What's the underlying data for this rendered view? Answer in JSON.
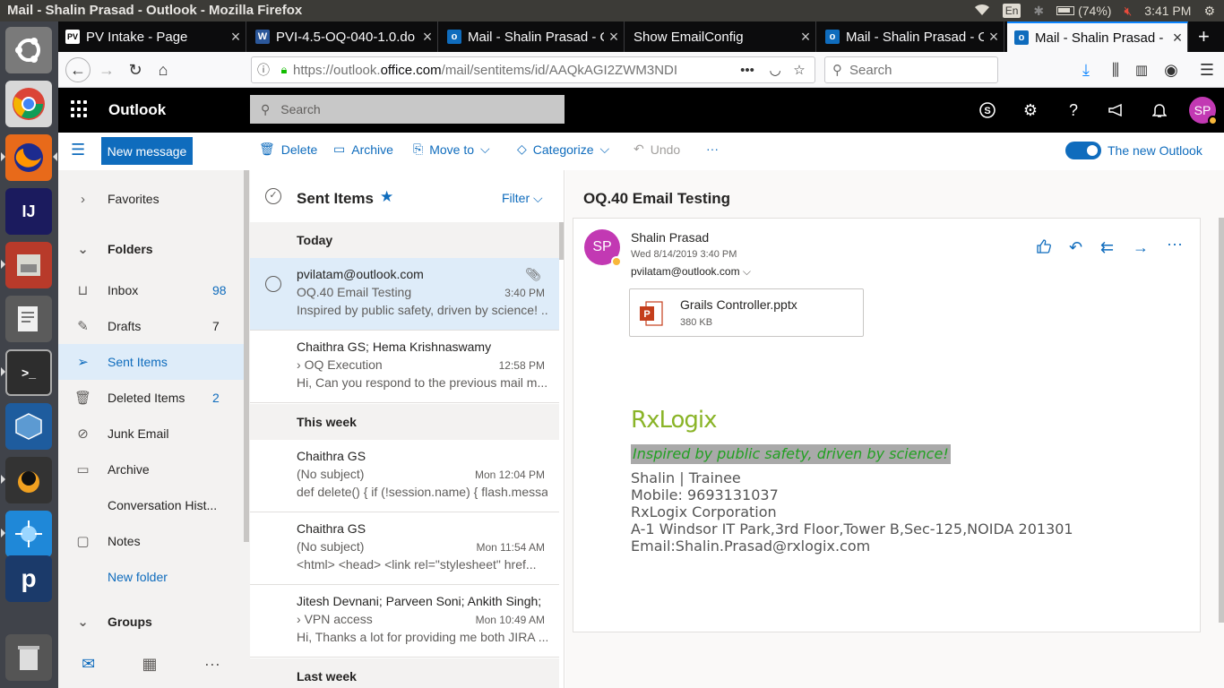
{
  "os": {
    "window_title": "Mail - Shalin Prasad - Outlook - Mozilla Firefox",
    "keyboard": "En",
    "battery": "(74%)",
    "clock": "3:41 PM"
  },
  "browser": {
    "tabs": [
      {
        "label": "PV Intake - Page",
        "icon": "pv-favicon"
      },
      {
        "label": "PVI-4.5-OQ-040-1.0.do",
        "icon": "word-favicon"
      },
      {
        "label": "Mail - Shalin Prasad - O",
        "icon": "outlook-favicon"
      },
      {
        "label": "Show EmailConfig",
        "icon": "none"
      },
      {
        "label": "Mail - Shalin Prasad - O",
        "icon": "outlook-favicon"
      },
      {
        "label": "Mail - Shalin Prasad - O",
        "icon": "outlook-favicon"
      }
    ],
    "url_prefix": "https://outlook.",
    "url_domain": "office.com",
    "url_path": "/mail/sentitems/id/AAQkAGI2ZWM3NDI",
    "search_placeholder": "Search"
  },
  "outlook": {
    "brand": "Outlook",
    "search_placeholder": "Search",
    "avatar_initials": "SP",
    "commands": {
      "new_message": "New message",
      "delete": "Delete",
      "archive": "Archive",
      "move_to": "Move to",
      "categorize": "Categorize",
      "undo": "Undo",
      "more": "···",
      "new_outlook": "The new Outlook"
    },
    "folders": {
      "favorites": "Favorites",
      "folders": "Folders",
      "items": [
        {
          "label": "Inbox",
          "count": "98",
          "icon": "inbox-icon"
        },
        {
          "label": "Drafts",
          "count": "7",
          "icon": "pencil-icon"
        },
        {
          "label": "Sent Items",
          "count": "",
          "icon": "send-icon"
        },
        {
          "label": "Deleted Items",
          "count": "2",
          "icon": "trash-icon"
        },
        {
          "label": "Junk Email",
          "count": "",
          "icon": "block-icon"
        },
        {
          "label": "Archive",
          "count": "",
          "icon": "archive-icon"
        },
        {
          "label": "Conversation Hist...",
          "count": "",
          "icon": "none"
        },
        {
          "label": "Notes",
          "count": "",
          "icon": "note-icon"
        }
      ],
      "new_folder": "New folder",
      "groups": "Groups"
    },
    "list": {
      "title": "Sent Items",
      "filter": "Filter",
      "groups": [
        "Today",
        "This week",
        "Last week"
      ],
      "messages": [
        {
          "from": "pvilatam@outlook.com",
          "subject": "OQ.40 Email Testing",
          "time": "3:40 PM",
          "preview": "Inspired by public safety, driven by science! ..."
        },
        {
          "from": "Chaithra GS; Hema Krishnaswamy",
          "subject": "OQ Execution",
          "time": "12:58 PM",
          "preview": "Hi, Can you respond to the previous mail m..."
        },
        {
          "from": "Chaithra GS",
          "subject": "(No subject)",
          "time": "Mon 12:04 PM",
          "preview": "def delete() { if (!session.name) { flash.messa..."
        },
        {
          "from": "Chaithra GS",
          "subject": "(No subject)",
          "time": "Mon 11:54 AM",
          "preview": "<html> <head> <link rel=\"stylesheet\" href..."
        },
        {
          "from": "Jitesh Devnani; Parveen Soni; Ankith Singh;",
          "subject": "VPN access",
          "time": "Mon 10:49 AM",
          "preview": "Hi, Thanks a lot for providing me both JIRA ..."
        }
      ]
    },
    "reading": {
      "subject": "OQ.40 Email Testing",
      "sender": "Shalin Prasad",
      "sender_initials": "SP",
      "date": "Wed 8/14/2019 3:40 PM",
      "to": "pvilatam@outlook.com",
      "attachment_name": "Grails Controller.pptx",
      "attachment_size": "380 KB",
      "logo_text": "RxLogix",
      "tagline": "Inspired by public safety, driven by science!",
      "sig_lines": [
        "Shalin | Trainee",
        "Mobile: 9693131037",
        "RxLogix Corporation",
        "A-1 Windsor IT Park,3rd Floor,Tower B,Sec-125,NOIDA 201301",
        "Email:Shalin.Prasad@rxlogix.com"
      ]
    }
  },
  "colors": {
    "accent": "#0f6cbd",
    "avatar": "#c239b3",
    "tagline_bg": "#a9a9a9",
    "tagline_fg": "#22a022"
  }
}
